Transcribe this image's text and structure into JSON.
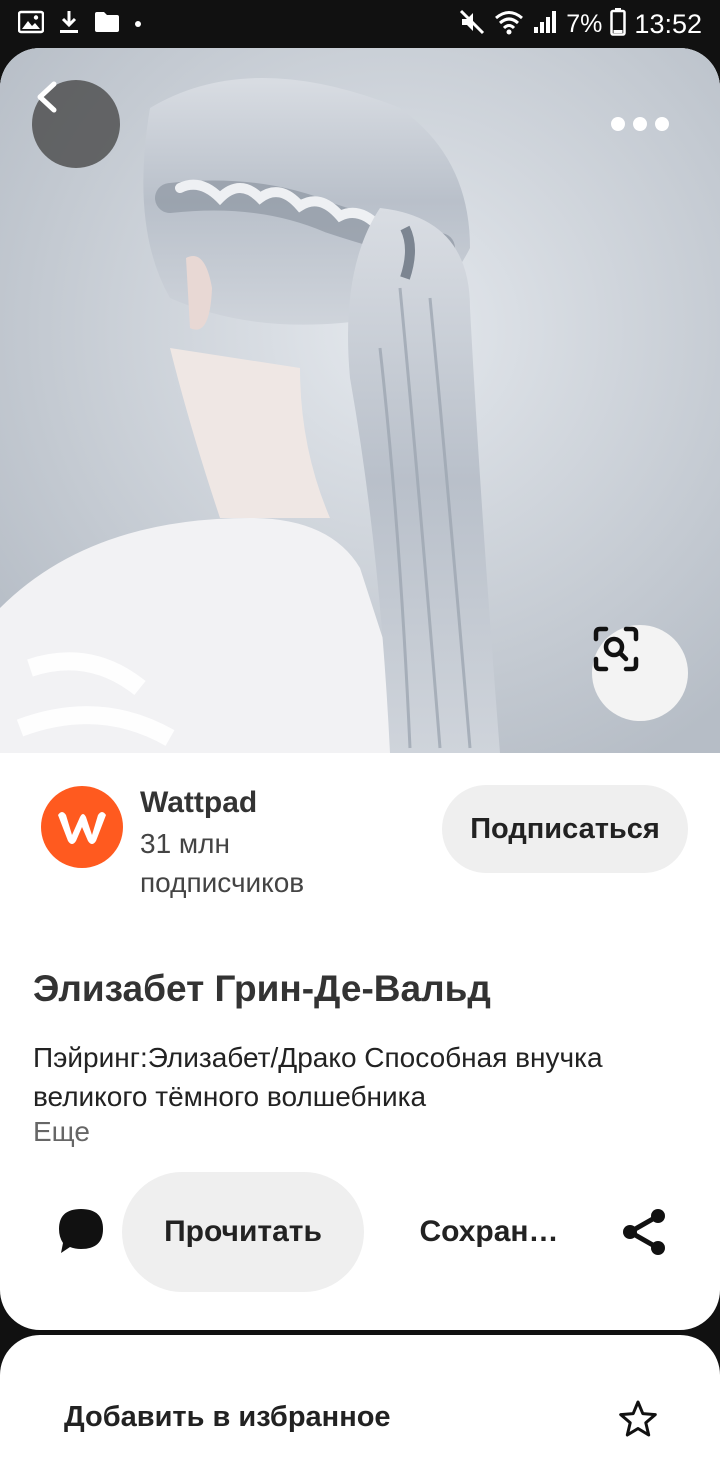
{
  "status_bar": {
    "battery_text": "7%",
    "time": "13:52",
    "icons": [
      "gallery-icon",
      "download-icon",
      "folder-icon",
      "dot-icon",
      "mute-icon",
      "wifi-icon",
      "signal-icon",
      "battery-icon"
    ]
  },
  "hero": {
    "description_icon_names": [
      "back-arrow-icon",
      "more-icon",
      "visual-search-icon"
    ]
  },
  "creator": {
    "name": "Wattpad",
    "followers": "31 млн подписчиков",
    "subscribe_label": "Подписаться",
    "brand_color": "#ff5a1f"
  },
  "pin": {
    "title": "Элизабет Грин-Де-Вальд",
    "description": "Пэйринг:Элизабет/Драко Способная внучка великого тёмного волшебника",
    "more_label": "Еще"
  },
  "actions": {
    "read_label": "Прочитать",
    "save_label": "Сохран…"
  },
  "sheet": {
    "favorite_label": "Добавить в избранное"
  }
}
